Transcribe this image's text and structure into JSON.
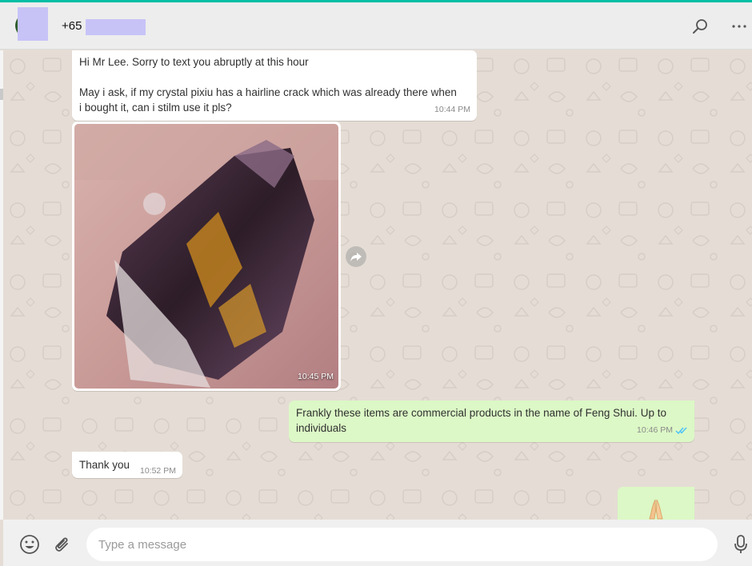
{
  "header": {
    "contact_prefix": "+65"
  },
  "messages": [
    {
      "direction": "incoming",
      "lines": [
        "Hi Mr Lee. Sorry to text you abruptly at this hour",
        "",
        "May i ask, if my crystal pixiu has a hairline crack which was already there when",
        "i bought it, can i stilm use it pls?"
      ],
      "time": "10:44 PM"
    },
    {
      "direction": "incoming",
      "type": "image",
      "time": "10:45 PM"
    },
    {
      "direction": "outgoing",
      "text": "Frankly these items are commercial products in the name of Feng Shui. Up to individuals",
      "time": "10:46 PM",
      "status": "read"
    },
    {
      "direction": "incoming",
      "text": "Thank you",
      "time": "10:52 PM"
    },
    {
      "direction": "outgoing",
      "type": "emoji",
      "emoji": "folded-hands"
    }
  ],
  "composer": {
    "placeholder": "Type a message"
  },
  "colors": {
    "accent": "#00bfa5",
    "outgoing_bubble": "#dcf8c6",
    "incoming_bubble": "#ffffff",
    "chat_background": "#e5ddd5",
    "read_ticks": "#4fc3f7"
  },
  "icons": [
    "search-icon",
    "more-menu-icon",
    "forward-icon",
    "emoji-icon",
    "paperclip-icon",
    "microphone-icon",
    "double-check-icon",
    "folded-hands-emoji"
  ]
}
